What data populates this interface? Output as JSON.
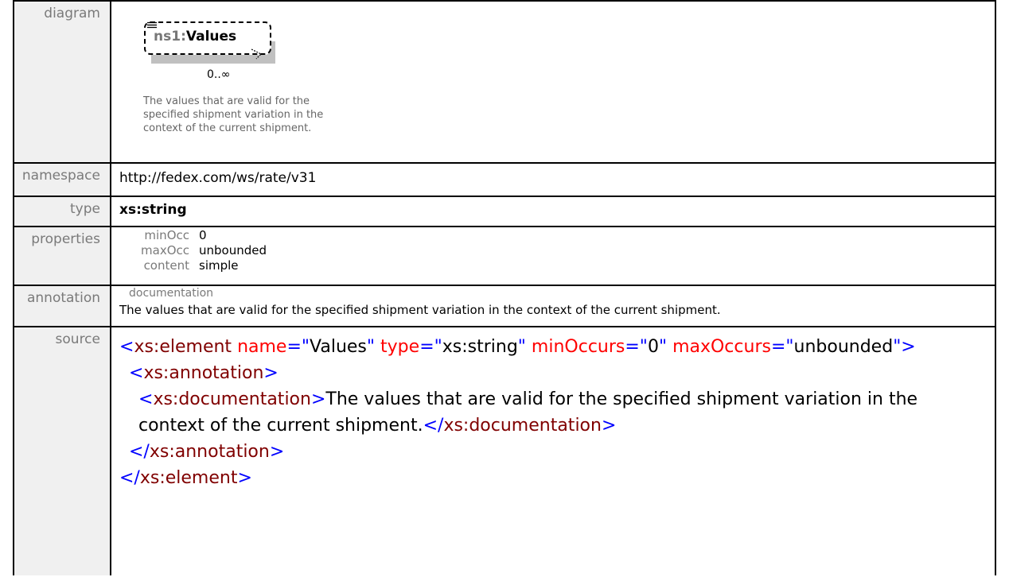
{
  "labels": {
    "diagram": "diagram",
    "namespace": "namespace",
    "type": "type",
    "properties": "properties",
    "annotation": "annotation",
    "source": "source"
  },
  "diagram": {
    "ns_prefix": "ns1",
    "separator": ":",
    "element_name": "Values",
    "occurrence": "0..∞",
    "documentation": "The values that are valid for the specified shipment variation in the context of the current shipment."
  },
  "namespace": "http://fedex.com/ws/rate/v31",
  "type": "xs:string",
  "properties": [
    {
      "key": "minOcc",
      "value": "0"
    },
    {
      "key": "maxOcc",
      "value": "unbounded"
    },
    {
      "key": "content",
      "value": "simple"
    }
  ],
  "annotation": {
    "key": "documentation",
    "text": "The values that are valid for the specified shipment variation in the context of the current shipment."
  },
  "source": {
    "lt": "<",
    "gt": ">",
    "close_lt": "</",
    "self_close": "\">",
    "el_tag": "xs:element",
    "attr_name": "name",
    "attr_name_val": "Values",
    "attr_type": "type",
    "attr_type_val": "xs:string",
    "attr_min": "minOccurs",
    "attr_min_val": "0",
    "attr_max": "maxOccurs",
    "attr_max_val": "unbounded",
    "eq_q": "=\"",
    "q": "\"",
    "annotation_tag": "xs:annotation",
    "documentation_tag": "xs:documentation",
    "doc_text": "The values that are valid for the specified shipment variation in the context of the current shipment."
  }
}
